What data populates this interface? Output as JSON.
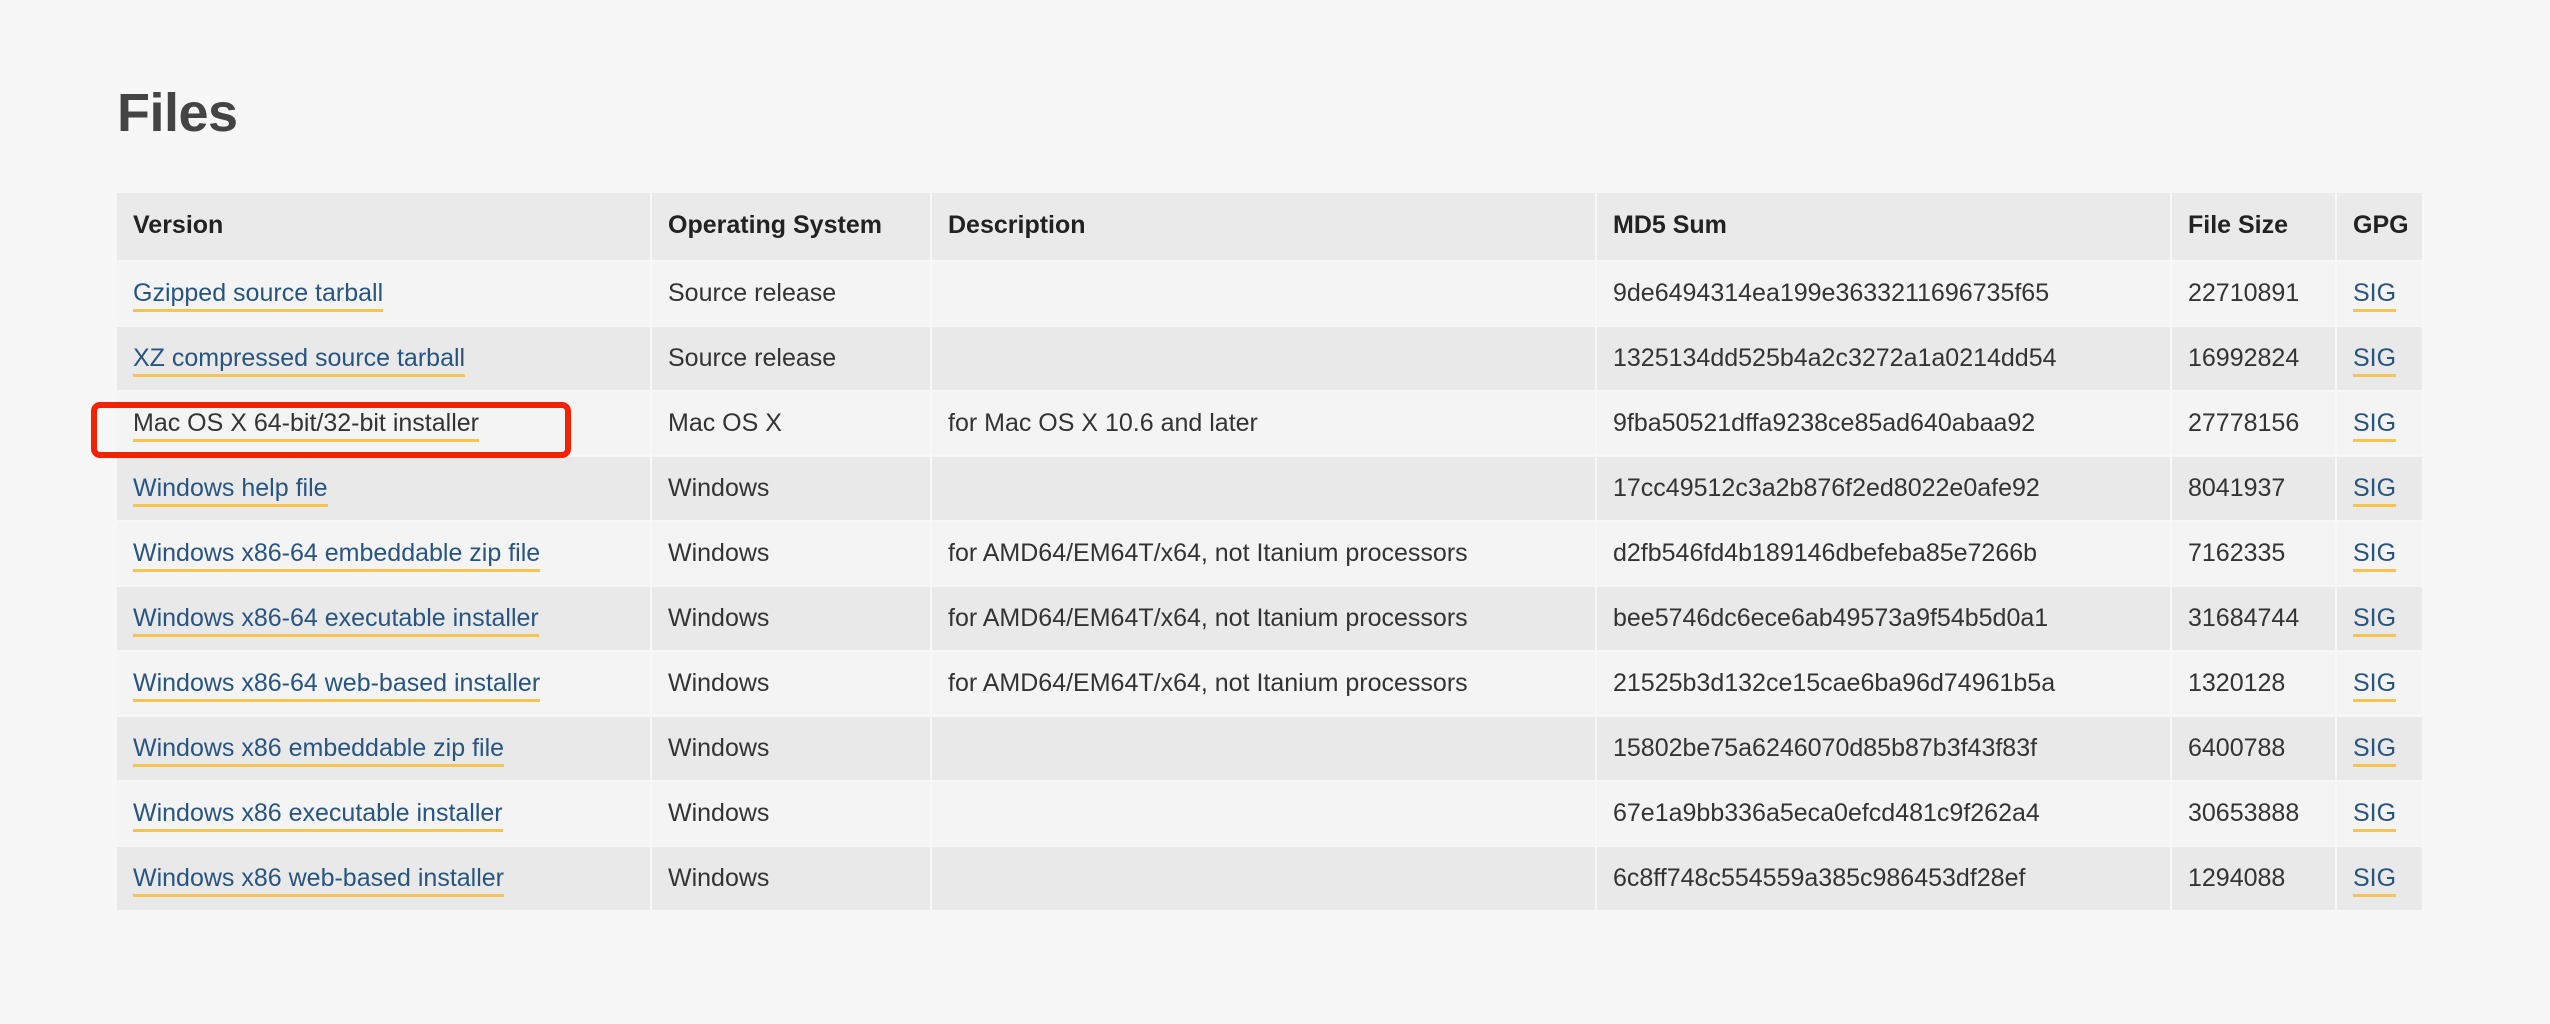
{
  "page": {
    "title": "Files",
    "background_color": "#f7f7f8",
    "title_color": "#444444",
    "link_color": "#27557f",
    "link_underline_color": "#f5c451",
    "highlight_color": "#f42204"
  },
  "table": {
    "headers": [
      "Version",
      "Operating System",
      "Description",
      "MD5 Sum",
      "File Size",
      "GPG"
    ],
    "gpg_label": "SIG",
    "rows": [
      {
        "version": "Gzipped source tarball",
        "os": "Source release",
        "description": "",
        "md5": "9de6494314ea199e3633211696735f65",
        "size": "22710891",
        "gpg": "SIG",
        "highlighted": false,
        "visited": false
      },
      {
        "version": "XZ compressed source tarball",
        "os": "Source release",
        "description": "",
        "md5": "1325134dd525b4a2c3272a1a0214dd54",
        "size": "16992824",
        "gpg": "SIG",
        "highlighted": false,
        "visited": false
      },
      {
        "version": "Mac OS X 64-bit/32-bit installer",
        "os": "Mac OS X",
        "description": "for Mac OS X 10.6 and later",
        "md5": "9fba50521dffa9238ce85ad640abaa92",
        "size": "27778156",
        "gpg": "SIG",
        "highlighted": true,
        "visited": true
      },
      {
        "version": "Windows help file",
        "os": "Windows",
        "description": "",
        "md5": "17cc49512c3a2b876f2ed8022e0afe92",
        "size": "8041937",
        "gpg": "SIG",
        "highlighted": false,
        "visited": false
      },
      {
        "version": "Windows x86-64 embeddable zip file",
        "os": "Windows",
        "description": "for AMD64/EM64T/x64, not Itanium processors",
        "md5": "d2fb546fd4b189146dbefeba85e7266b",
        "size": "7162335",
        "gpg": "SIG",
        "highlighted": false,
        "visited": false
      },
      {
        "version": "Windows x86-64 executable installer",
        "os": "Windows",
        "description": "for AMD64/EM64T/x64, not Itanium processors",
        "md5": "bee5746dc6ece6ab49573a9f54b5d0a1",
        "size": "31684744",
        "gpg": "SIG",
        "highlighted": false,
        "visited": false
      },
      {
        "version": "Windows x86-64 web-based installer",
        "os": "Windows",
        "description": "for AMD64/EM64T/x64, not Itanium processors",
        "md5": "21525b3d132ce15cae6ba96d74961b5a",
        "size": "1320128",
        "gpg": "SIG",
        "highlighted": false,
        "visited": false
      },
      {
        "version": "Windows x86 embeddable zip file",
        "os": "Windows",
        "description": "",
        "md5": "15802be75a6246070d85b87b3f43f83f",
        "size": "6400788",
        "gpg": "SIG",
        "highlighted": false,
        "visited": false
      },
      {
        "version": "Windows x86 executable installer",
        "os": "Windows",
        "description": "",
        "md5": "67e1a9bb336a5eca0efcd481c9f262a4",
        "size": "30653888",
        "gpg": "SIG",
        "highlighted": false,
        "visited": false
      },
      {
        "version": "Windows x86 web-based installer",
        "os": "Windows",
        "description": "",
        "md5": "6c8ff748c554559a385c986453df28ef",
        "size": "1294088",
        "gpg": "SIG",
        "highlighted": false,
        "visited": false
      }
    ]
  }
}
